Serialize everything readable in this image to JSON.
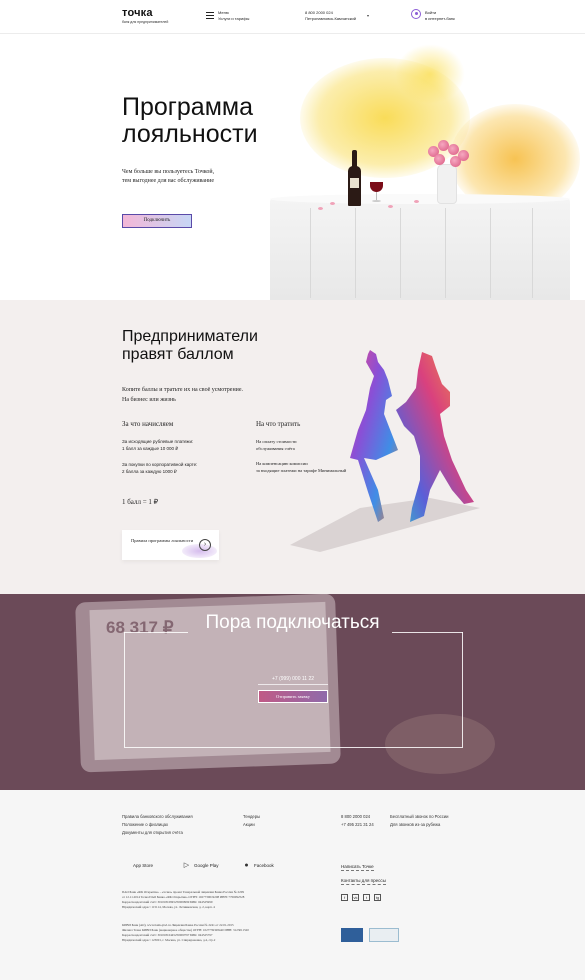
{
  "header": {
    "logo": "точка",
    "logo_sub": "банк для предпринимателей",
    "menu_label": "Меню",
    "menu_sub": "Услуги и тарифы",
    "phone": "8 800 2000 024",
    "city": "Петропавловск-Камчатский",
    "login_label": "Войти",
    "login_sub": "в интернет-банк"
  },
  "hero": {
    "title_line1": "Программа",
    "title_line2": "лояльности",
    "desc_line1": "Чем больше вы пользуетесь Точкой,",
    "desc_line2": "тем выгоднее для вас обслуживание",
    "connect_button": "Подключить"
  },
  "loyalty": {
    "title_line1": "Предприниматели",
    "title_line2": "правят баллом",
    "desc_line1": "Копите баллы и тратьте их на своё усмотрение.",
    "desc_line2": "На бизнес или жизнь",
    "earn_heading": "За что начисляем",
    "spend_heading": "На что тратить",
    "earn_items": [
      {
        "line1": "За исходящие рублевые платежи:",
        "line2": "1 балл за каждые 10 000 ₽"
      },
      {
        "line1": "За покупки по корпоративной карте:",
        "line2": "2 балла за каждую 1000 ₽"
      }
    ],
    "spend_items": [
      {
        "line1": "На оплату стоимости",
        "line2": "обслуживания счёта"
      },
      {
        "line1": "На компенсацию комиссии",
        "line2": "за входящие платежи на тарифе Минимальный"
      }
    ],
    "rate": "1 балл = 1 ₽",
    "rules_link": "Правила программы лояльности"
  },
  "connect": {
    "title": "Пора подключаться",
    "phone": "+7 (999) 000 11 22",
    "submit": "Отправить заявку",
    "bg_amount": "68 317 ₽"
  },
  "footer": {
    "col1": [
      "Правила банковского обслуживания",
      "Положение о физлицах",
      "Документы для открытия счёта"
    ],
    "col2": [
      "Тендеры",
      "Акции"
    ],
    "col3": [
      "8 800 2000 024",
      "+7 495 221 31 24"
    ],
    "col4": [
      "Бесплатный звонок по России",
      "Для звонков из-за рубежа"
    ],
    "apps": [
      "App Store",
      "Google Play",
      "Facebook"
    ],
    "write_us": "Написать Точке",
    "press": "Контакты для прессы",
    "social": [
      "f",
      "vk",
      "t",
      "tg"
    ],
    "legal_1": [
      "ПАО Банк «ФК Открытие» - «точка» проект Генеральной лицензии Банка России № 2209",
      "от 12.11.2014 Точка ПАО Банка «ФК Открытие» ОГРН: 1027739019208 ИНН: 7706092528",
      "Корреспондентский счёт: 30101810845250000999 БИК: 044525999",
      "Юридический адрес: 115114, Москва, ул. Летниковская, д. 2, корп. 4"
    ],
    "legal_2": [
      "КИВИ Банк (АО), www.bank.qiwi.ru Лицензия Банка России № 2241 от 22.01.2015",
      "Филиал Точка КИВИ Банк (акционерное общество) ОГРН: 1027739328440 ИНН: 3123011520",
      "Корреспондентский счёт: 30101810445250000797 БИК: 044525797",
      "Юридический адрес: 123001, г. Москва, ул. Спиридоновка, д.4, стр.2"
    ]
  },
  "colors": {
    "accent_purple": "#5a4aa8",
    "loyalty_bg": "#f3efee",
    "connect_bg": "#6b4a58",
    "footer_bg": "#f6f6f6",
    "splash_yellow": "#f7d64a"
  }
}
